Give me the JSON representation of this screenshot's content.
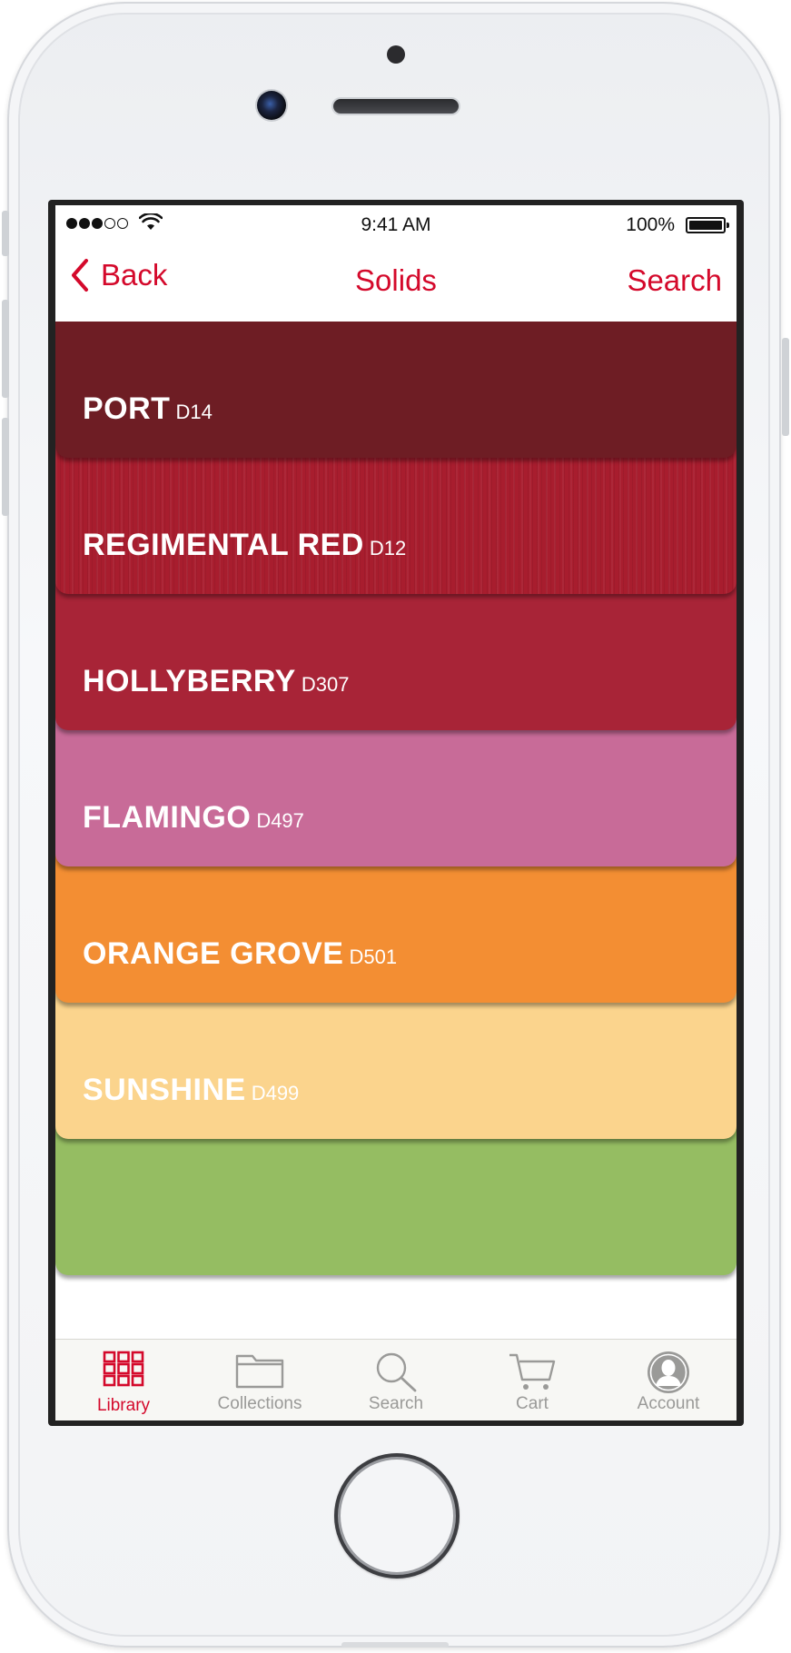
{
  "status_bar": {
    "time": "9:41 AM",
    "battery_percent": "100%",
    "signal_bars_filled": 3,
    "signal_bars_total": 5
  },
  "nav": {
    "back_label": "Back",
    "title": "Solids",
    "search_label": "Search"
  },
  "swatches": [
    {
      "name": "PORT",
      "code": "D14",
      "color": "#6e1d24"
    },
    {
      "name": "REGIMENTAL RED",
      "code": "D12",
      "color": "#a81d2e"
    },
    {
      "name": "HOLLYBERRY",
      "code": "D307",
      "color": "#a82437"
    },
    {
      "name": "FLAMINGO",
      "code": "D497",
      "color": "#c86b98"
    },
    {
      "name": "ORANGE GROVE",
      "code": "D501",
      "color": "#f38e33"
    },
    {
      "name": "SUNSHINE",
      "code": "D499",
      "color": "#fbd48d"
    },
    {
      "name": "",
      "code": "",
      "color": "#95bd62"
    }
  ],
  "tabs": [
    {
      "label": "Library",
      "icon": "grid-icon",
      "active": true
    },
    {
      "label": "Collections",
      "icon": "folder-icon",
      "active": false
    },
    {
      "label": "Search",
      "icon": "search-icon",
      "active": false
    },
    {
      "label": "Cart",
      "icon": "cart-icon",
      "active": false
    },
    {
      "label": "Account",
      "icon": "account-icon",
      "active": false
    }
  ],
  "colors": {
    "accent": "#d4092b",
    "tab_inactive": "#9a9a98",
    "tab_bar_bg": "#f7f7f4"
  }
}
